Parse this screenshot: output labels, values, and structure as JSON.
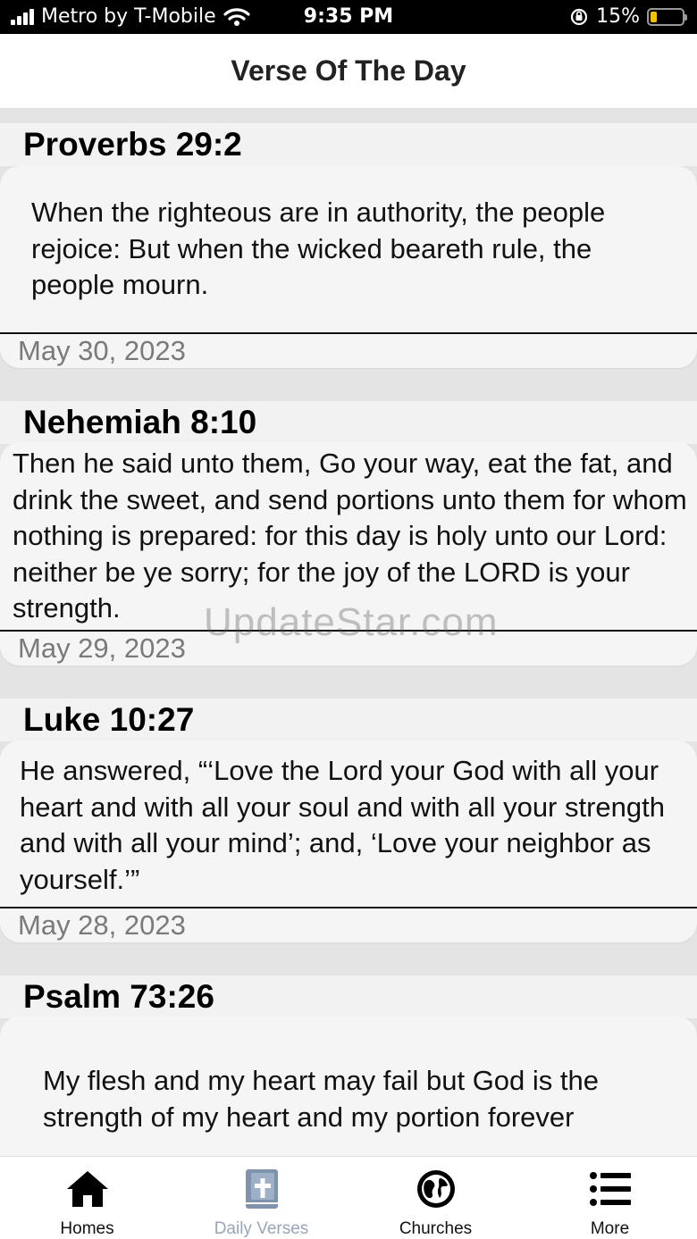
{
  "status_bar": {
    "carrier": "Metro by T-Mobile",
    "time": "9:35 PM",
    "battery_percent": "15%",
    "battery_level": 0.15
  },
  "header": {
    "title": "Verse Of The Day"
  },
  "verses": [
    {
      "reference": "Proverbs 29:2",
      "text": "When the righteous are in authority, the people rejoice: But when the wicked beareth rule, the people mourn.",
      "date": "May 30, 2023"
    },
    {
      "reference": "Nehemiah 8:10",
      "text": "Then he said unto them, Go your way, eat the fat, and drink the sweet, and send portions unto them for whom nothing is prepared: for this day is holy unto our Lord: neither be ye sorry; for the joy of the LORD is your strength.",
      "date": "May 29, 2023"
    },
    {
      "reference": "Luke 10:27",
      "text": "He answered, “‘Love the Lord your God with all your heart and with all your soul and with all your strength and with all your mind’; and, ‘Love your neighbor as yourself.’”",
      "date": "May 28, 2023"
    },
    {
      "reference": "Psalm 73:26",
      "text": "My flesh and my heart may fail but God is the strength of my heart and my portion forever",
      "date": ""
    }
  ],
  "watermark": "UpdateStar.com",
  "tabs": [
    {
      "label": "Homes",
      "icon": "home-icon",
      "active": false
    },
    {
      "label": "Daily Verses",
      "icon": "bible-icon",
      "active": true
    },
    {
      "label": "Churches",
      "icon": "globe-icon",
      "active": false
    },
    {
      "label": "More",
      "icon": "list-icon",
      "active": false
    }
  ],
  "colors": {
    "active_tab": "#98a6b8",
    "battery": "#f4c300",
    "page_background": "#e4e4e4"
  }
}
